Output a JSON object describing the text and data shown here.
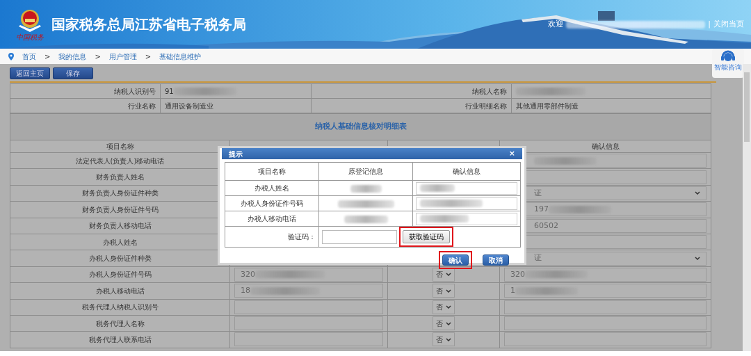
{
  "header": {
    "title": "国家税务总局江苏省电子税务局",
    "logo_caption": "中国税务",
    "welcome": "欢迎",
    "welcome_redacted": true,
    "separator": "|",
    "close_link": "关闭当页"
  },
  "breadcrumb": {
    "separator": ">",
    "items": [
      "首页",
      "我的信息",
      "用户管理",
      "基础信息维护"
    ]
  },
  "help": {
    "label": "智能咨询"
  },
  "toolbar": [
    "返回主页",
    "保存"
  ],
  "info_rows": [
    {
      "label": "纳税人识别号",
      "value": "91",
      "value_redacted": true,
      "label_2": "纳税人名称",
      "value_2": "",
      "value_2_redacted": true
    },
    {
      "label": "行业名称",
      "value": "通用设备制造业",
      "value_redacted": false,
      "label_2": "行业明细名称",
      "value_2": "其他通用零部件制造",
      "value_2_redacted": false
    }
  ],
  "table": {
    "title": "纳税人基础信息核对明细表",
    "columns": {
      "column_1": "项目名称",
      "column_4": "确认信息"
    },
    "rows": [
      {
        "label": "法定代表人(负责人)移动电话",
        "kind": "input",
        "confirm": "",
        "confirm_redacted": true
      },
      {
        "label": "财务负责人姓名",
        "kind": "input",
        "confirm": "",
        "confirm_redacted": false
      },
      {
        "label": "财务负责人身份证件种类",
        "kind": "select",
        "confirm": "证",
        "confirm_redacted": false
      },
      {
        "label": "财务负责人身份证件号码",
        "kind": "input",
        "confirm": "197",
        "confirm_redacted": true
      },
      {
        "label": "财务负责人移动电话",
        "kind": "input",
        "confirm": "60502",
        "confirm_redacted": false
      },
      {
        "label": "办税人姓名",
        "kind": "input",
        "confirm": "",
        "confirm_redacted": false
      },
      {
        "label": "办税人身份证件种类",
        "kind": "select",
        "confirm": "证",
        "confirm_redacted": false
      },
      {
        "label": "办税人身份证件号码",
        "original": "320",
        "original_redacted": true,
        "modify": "否",
        "kind": "input",
        "confirm": "320",
        "confirm_redacted": true
      },
      {
        "label": "办税人移动电话",
        "original": "18",
        "original_redacted": true,
        "modify": "否",
        "kind": "input",
        "confirm": "1",
        "confirm_redacted": true
      },
      {
        "label": "税务代理人纳税人识别号",
        "original": "",
        "original_redacted": false,
        "modify": "否",
        "kind": "input",
        "confirm": "",
        "confirm_redacted": false
      },
      {
        "label": "税务代理人名称",
        "original": "",
        "original_redacted": false,
        "modify": "否",
        "kind": "input",
        "confirm": "",
        "confirm_redacted": false
      },
      {
        "label": "税务代理人联系电话",
        "original": "",
        "original_redacted": false,
        "modify": "否",
        "kind": "input",
        "confirm": "",
        "confirm_redacted": false
      }
    ]
  },
  "dialog": {
    "title": "提示",
    "close": "×",
    "columns": [
      "项目名称",
      "原登记信息",
      "确认信息"
    ],
    "rows": [
      {
        "label": "办税人姓名"
      },
      {
        "label": "办税人身份证件号码"
      },
      {
        "label": "办税人移动电话"
      }
    ],
    "captcha_label": "验证码：",
    "captcha_button": {
      "label": "获取验证码",
      "highlighted": true
    },
    "buttons": [
      {
        "label": "确认",
        "highlighted": true
      },
      {
        "label": "取消",
        "highlighted": false
      }
    ]
  }
}
